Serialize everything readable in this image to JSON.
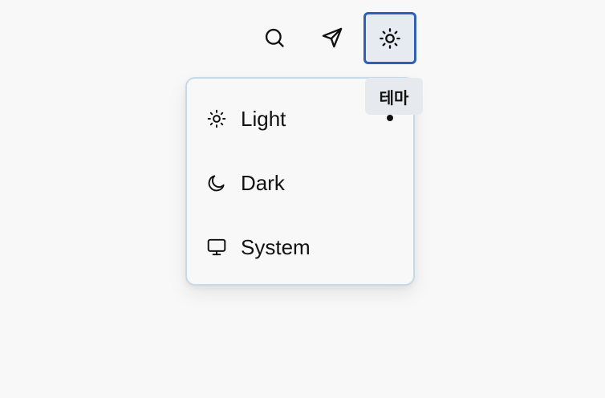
{
  "header": {
    "buttons": [
      {
        "icon": "search-icon"
      },
      {
        "icon": "send-icon"
      },
      {
        "icon": "sun-icon"
      }
    ]
  },
  "tooltip": {
    "text": "테마"
  },
  "theme_menu": {
    "items": [
      {
        "icon": "sun-icon",
        "label": "Light",
        "selected": true
      },
      {
        "icon": "moon-icon",
        "label": "Dark",
        "selected": false
      },
      {
        "icon": "monitor-icon",
        "label": "System",
        "selected": false
      }
    ]
  },
  "colors": {
    "background": "#f8f8f8",
    "focus_ring": "#2f5fb7",
    "menu_border": "#c5daea",
    "tooltip_bg": "#e6eaef",
    "text": "#111111"
  }
}
